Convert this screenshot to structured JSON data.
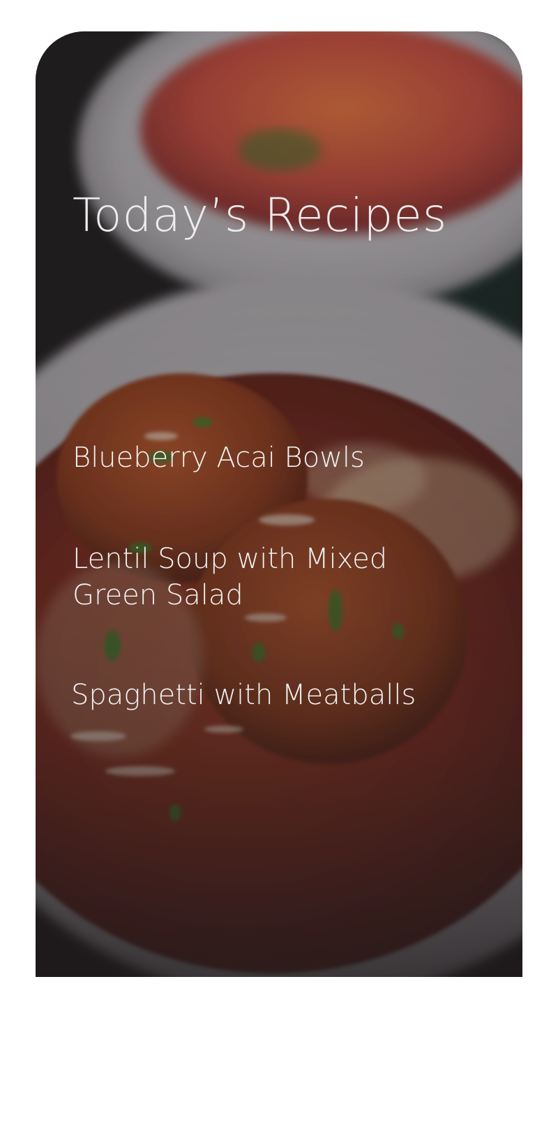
{
  "header": {
    "title": "Today’s Recipes"
  },
  "recipes": [
    {
      "label": "Blueberry Acai Bowls"
    },
    {
      "label": "Lentil Soup with Mixed Green Salad"
    },
    {
      "label": "Spaghetti with Meatballs"
    }
  ],
  "background": {
    "image": "spaghetti-and-meatballs-photo",
    "accent_text_color": "#ececec",
    "card_base_color": "#231f20"
  }
}
